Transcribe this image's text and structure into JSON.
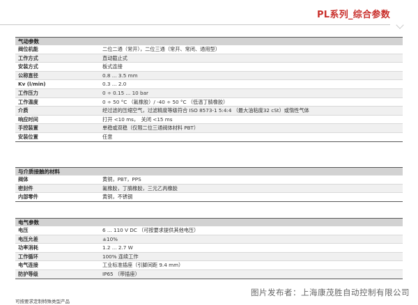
{
  "header": {
    "title": "PL系列_综合参数"
  },
  "sections": [
    {
      "title": "气动参数",
      "rows": [
        {
          "label": "阀位机能",
          "value": "二位二通（常开），二位三通（常开、常闭、通用型）"
        },
        {
          "label": "工作方式",
          "value": "直动截止式"
        },
        {
          "label": "安装方式",
          "value": "板式连接"
        },
        {
          "label": "公称直径",
          "value": "0.8 ... 3.5 mm"
        },
        {
          "label": "Kv (l/min)",
          "value": "0.3 ... 2.0"
        },
        {
          "label": "工作压力",
          "value": "0 ÷ 0.15 ... 10 bar"
        },
        {
          "label": "工作温度",
          "value": "0 ÷ 50 °C （氟橡胶）/ -40 ÷ 50 °C （低温丁腈橡胶）"
        },
        {
          "label": "介质",
          "value": "经过滤的压缩空气，过滤精度等级符合 ISO 8573-1 5:4:4 （最大油粘度32 cSt）或惰性气体"
        },
        {
          "label": "响应时间",
          "value": "打开 <10 ms，　关闭 <15 ms"
        },
        {
          "label": "手控装置",
          "value": "单稳或双稳（仅限二位三通阀体材料 PBT）"
        },
        {
          "label": "安装位置",
          "value": "任意"
        }
      ]
    },
    {
      "title": "与介质接触的材料",
      "rows": [
        {
          "label": "阀体",
          "value": "黄铜，PBT，PPS"
        },
        {
          "label": "密封件",
          "value": "氟橡胶，丁腈橡胶，三元乙丙橡胶"
        },
        {
          "label": "内部零件",
          "value": "黄铜，不锈钢"
        }
      ]
    },
    {
      "title": "电气参数",
      "rows": [
        {
          "label": "电压",
          "value": "6 ... 110 V DC （可按要求提供其他电压）"
        },
        {
          "label": "电压允差",
          "value": "±10%"
        },
        {
          "label": "功率消耗",
          "value": "1.2 ... 2.7 W"
        },
        {
          "label": "工作循环",
          "value": "100% 连续工作"
        },
        {
          "label": "电气连接",
          "value": "工业标准插座（引脚间距 9.4 mm）"
        },
        {
          "label": "防护等级",
          "value": "IP65 （带插座）"
        }
      ]
    }
  ],
  "footnote": "可按要求定制特殊类型产品",
  "watermark": "图片发布者：上海康茂胜自动控制有限公司",
  "colors": {
    "accent": "#c9302c",
    "section_bg": "#d2d2d2"
  }
}
